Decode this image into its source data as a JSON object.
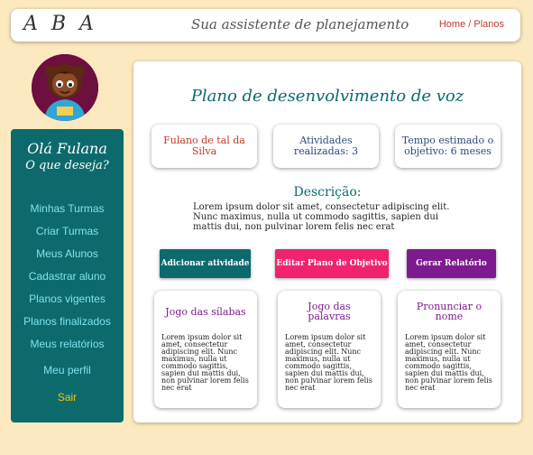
{
  "header": {
    "logo": "A B A",
    "tagline": "Sua assistente de planejamento",
    "breadcrumb_home": "Home",
    "breadcrumb_sep": " / ",
    "breadcrumb_current": "Planos"
  },
  "sidebar": {
    "greeting": "Olá Fulana",
    "question": "O que deseja?",
    "items": [
      {
        "label": "Minhas Turmas"
      },
      {
        "label": "Criar Turmas"
      },
      {
        "label": "Meus Alunos"
      },
      {
        "label": "Cadastrar aluno"
      },
      {
        "label": "Planos vigentes"
      },
      {
        "label": "Planos finalizados"
      },
      {
        "label": "Meus relatórios"
      },
      {
        "label": "Meu perfil"
      }
    ],
    "exit": "Sair"
  },
  "main": {
    "title": "Plano de desenvolvimento de voz",
    "stats": {
      "student": "Fulano de tal da Silva",
      "activities": "Atividades realizadas: 3",
      "time": "Tempo estimado o objetivo: 6 meses"
    },
    "description_title": "Descrição:",
    "description": "Lorem ipsum dolor sit amet, consectetur adipiscing elit. Nunc maximus, nulla ut commodo sagittis, sapien dui mattis dui, non pulvinar lorem felis nec erat",
    "buttons": {
      "add": "Adicionar atividade",
      "edit": "Editar Plano de Objetivo",
      "report": "Gerar Relatório"
    },
    "cards": [
      {
        "title": "Jogo das sílabas",
        "text": "Lorem ipsum dolor sit amet, consectetur adipiscing elit. Nunc maximus, nulla ut commodo sagittis, sapien dui mattis dui, non pulvinar lorem felis nec erat"
      },
      {
        "title": "Jogo das palavras",
        "text": "Lorem ipsum dolor sit amet, consectetur adipiscing elit. Nunc maximus, nulla ut commodo sagittis, sapien dui mattis dui, non pulvinar lorem felis nec erat"
      },
      {
        "title": "Pronunciar o nome",
        "text": "Lorem ipsum dolor sit amet, consectetur adipiscing elit. Nunc maximus, nulla ut commodo sagittis, sapien dui mattis dui, non pulvinar lorem felis nec erat"
      }
    ]
  },
  "colors": {
    "background": "#fde9bf",
    "teal": "#0c6a6d",
    "pink": "#f0236f",
    "purple": "#7d1a8f",
    "menu_text": "#7fe3ec",
    "exit_text": "#f0c419"
  }
}
